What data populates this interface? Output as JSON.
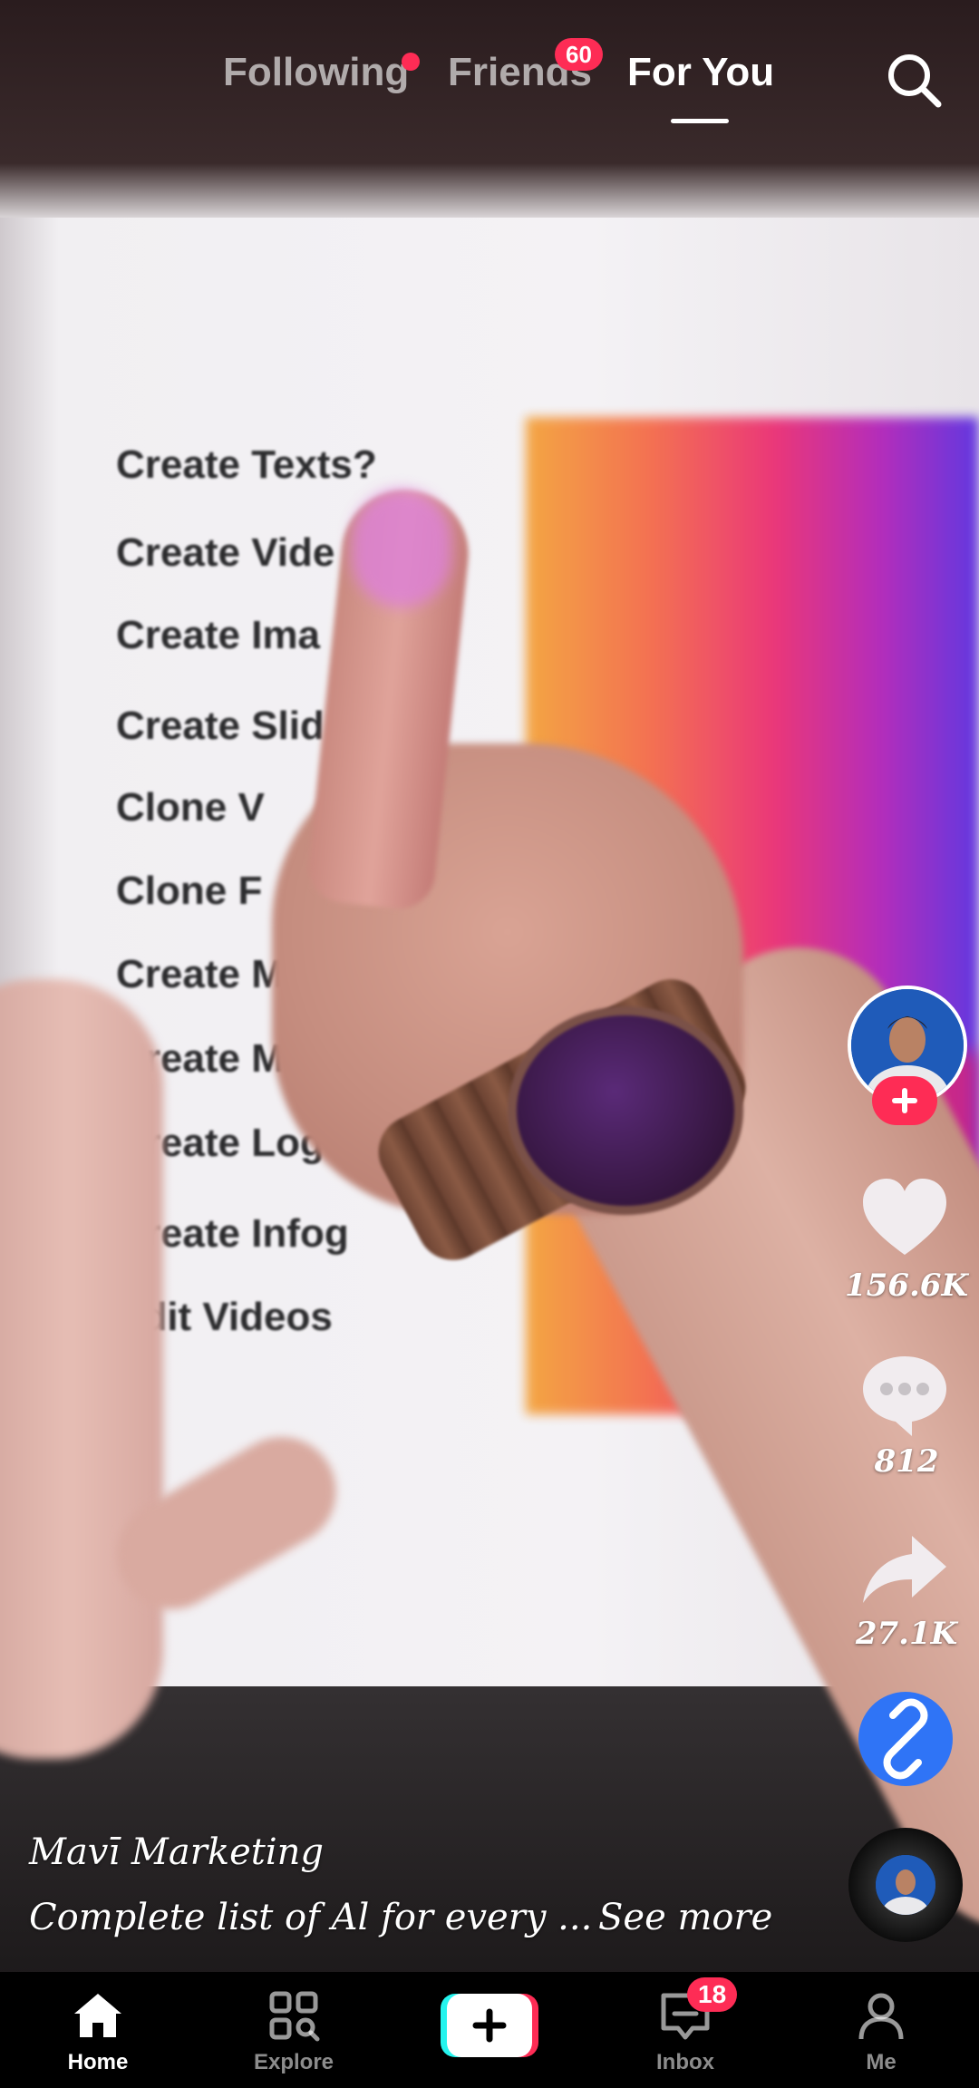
{
  "top_tabs": {
    "following": "Following",
    "friends": "Friends",
    "friends_badge": "60",
    "for_you": "For You"
  },
  "video_text": {
    "items": [
      "Create Texts?",
      "Create Vide",
      "Create Ima",
      "Create Slid",
      "Clone V",
      "Clone F",
      "Create M",
      "Create Mi",
      "Create Logo",
      "Create Infog",
      "Edit Videos"
    ]
  },
  "rail": {
    "likes": "156.6K",
    "comments": "812",
    "shares": "27.1K"
  },
  "caption": {
    "author": "Mavī Marketing",
    "description": "Complete list of Al for every ...",
    "see_more": "See more"
  },
  "bottom_nav": {
    "home": "Home",
    "explore": "Explore",
    "inbox": "Inbox",
    "inbox_badge": "18",
    "me": "Me"
  },
  "colors": {
    "accent_red": "#fe2c55",
    "link_blue": "#2f74f6",
    "create_cyan": "#25f4ee"
  },
  "icons": [
    "search-icon",
    "plus-icon",
    "heart-icon",
    "comment-icon",
    "share-icon",
    "link-icon",
    "home-icon",
    "explore-icon",
    "create-icon",
    "inbox-icon",
    "profile-icon"
  ]
}
